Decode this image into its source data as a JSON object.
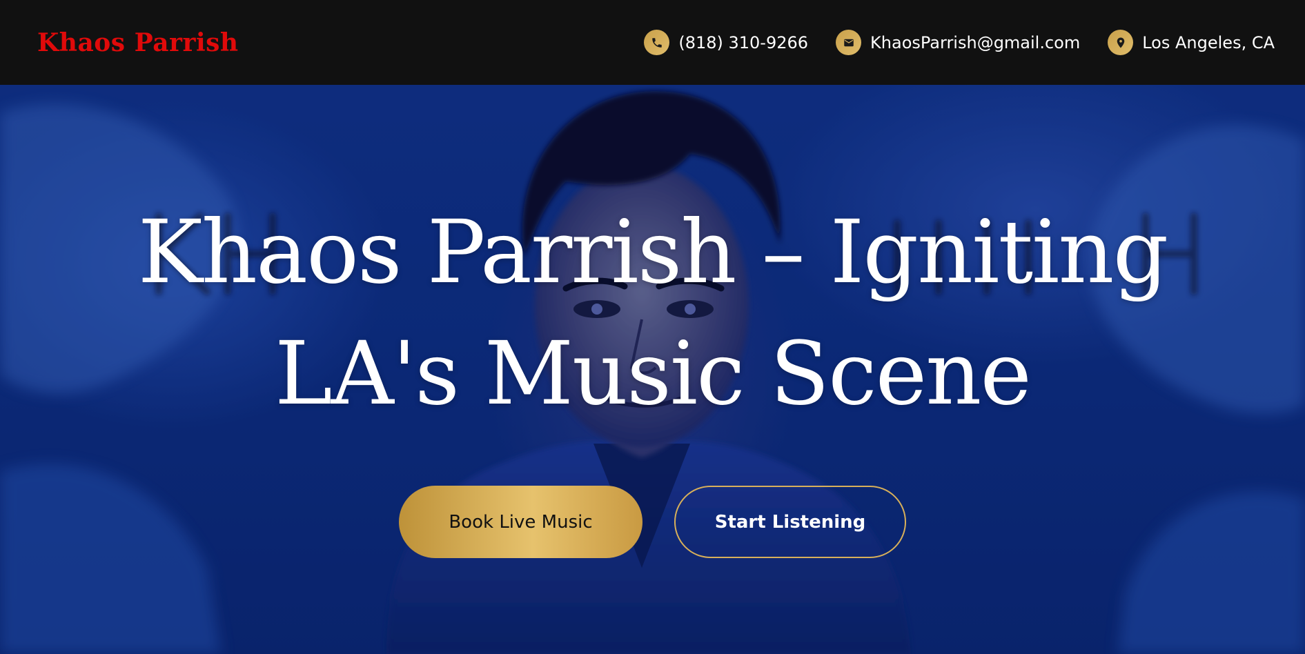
{
  "header": {
    "logo": "Khaos Parrish",
    "contacts": [
      {
        "icon": "phone-icon",
        "text": "(818) 310-9266"
      },
      {
        "icon": "mail-icon",
        "text": "KhaosParrish@gmail.com"
      },
      {
        "icon": "location-pin-icon",
        "text": "Los Angeles, CA"
      }
    ]
  },
  "hero": {
    "title_line1": "Khaos Parrish – Igniting",
    "title_line2": "LA's Music Scene",
    "buttons": {
      "primary": "Book Live Music",
      "secondary": "Start Listening"
    },
    "background_image": "blue-toned painted portrait of a dark-haired man"
  },
  "colors": {
    "logo": "#e00a0a",
    "accent_gold": "#d8b05a",
    "topbar": "#111111",
    "hero_blue": "#123a9f"
  }
}
